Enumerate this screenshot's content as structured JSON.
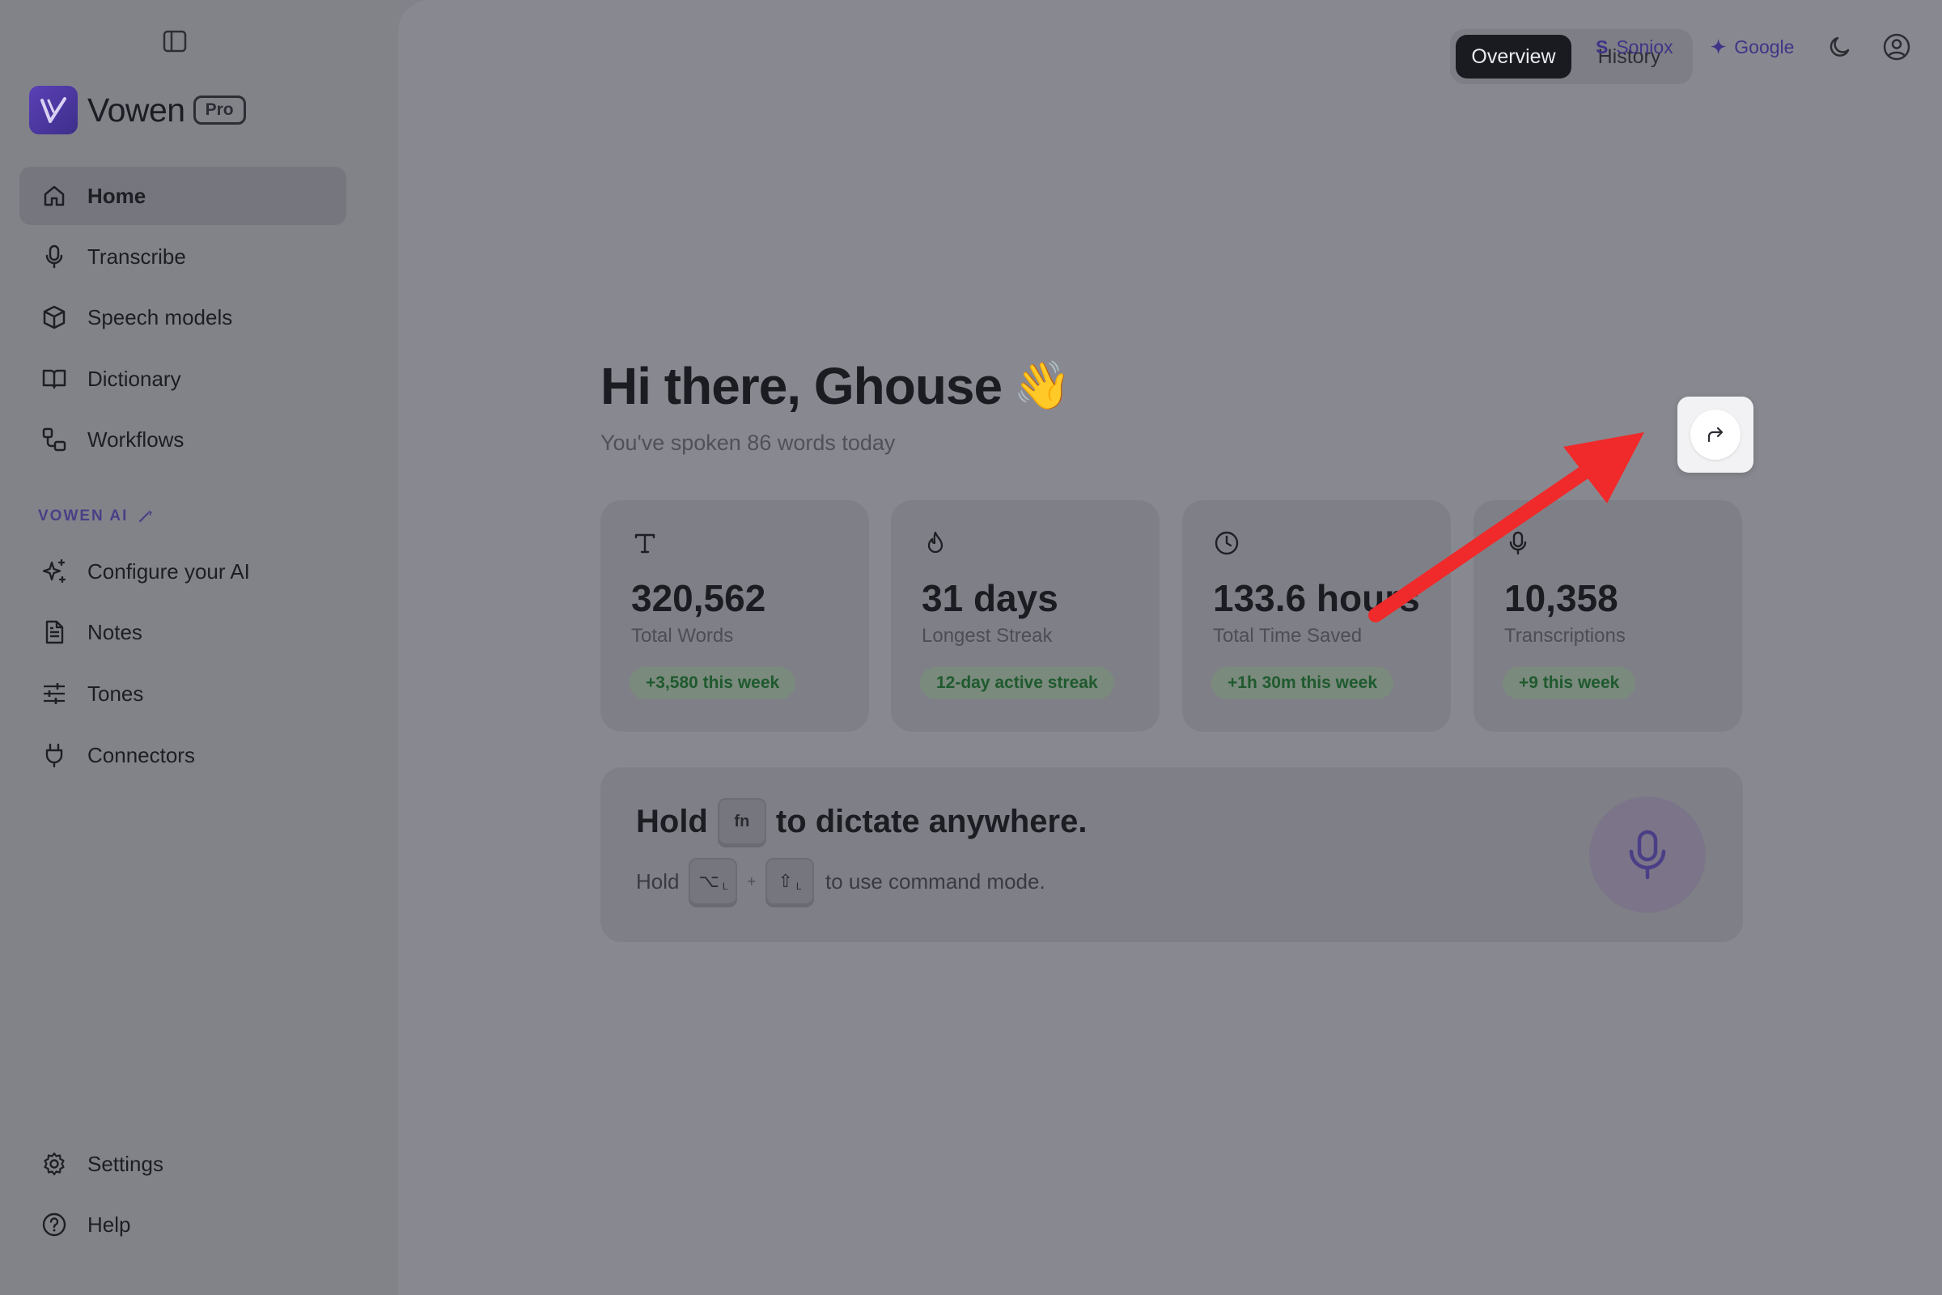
{
  "sidebar": {
    "brand": "Vowen",
    "plan_badge": "Pro",
    "items": [
      {
        "label": "Home",
        "icon": "home-icon"
      },
      {
        "label": "Transcribe",
        "icon": "microphone-icon"
      },
      {
        "label": "Speech models",
        "icon": "cube-icon"
      },
      {
        "label": "Dictionary",
        "icon": "book-icon"
      },
      {
        "label": "Workflows",
        "icon": "workflow-icon"
      }
    ],
    "ai_section_title": "VOWEN AI",
    "ai_items": [
      {
        "label": "Configure your AI",
        "icon": "sparkles-icon"
      },
      {
        "label": "Notes",
        "icon": "document-icon"
      },
      {
        "label": "Tones",
        "icon": "sliders-icon"
      },
      {
        "label": "Connectors",
        "icon": "plug-icon"
      }
    ],
    "bottom_items": [
      {
        "label": "Settings",
        "icon": "gear-icon"
      },
      {
        "label": "Help",
        "icon": "help-icon"
      }
    ]
  },
  "header": {
    "tabs": [
      "Overview",
      "History"
    ],
    "active_tab": "Overview",
    "providers": [
      {
        "label": "Soniox",
        "glyph": "S"
      },
      {
        "label": "Google",
        "glyph": "✦"
      }
    ]
  },
  "main": {
    "greeting": "Hi there, Ghouse",
    "greeting_emoji": "👋",
    "subtitle": "You've spoken 86 words today",
    "stats": [
      {
        "value": "320,562",
        "label": "Total Words",
        "badge": "+3,580 this week",
        "icon": "text-icon"
      },
      {
        "value": "31 days",
        "label": "Longest Streak",
        "badge": "12-day active streak",
        "icon": "flame-icon"
      },
      {
        "value": "133.6 hours",
        "label": "Total Time Saved",
        "badge": "+1h 30m this week",
        "icon": "clock-icon"
      },
      {
        "value": "10,358",
        "label": "Transcriptions",
        "badge": "+9 this week",
        "icon": "microphone-icon"
      }
    ],
    "dictate": {
      "hold": "Hold",
      "key_fn": "fn",
      "title_rest": "to dictate anywhere.",
      "sub_hold": "Hold",
      "key_option": "⌥",
      "key_shift": "⇧",
      "key_side": "L",
      "plus": "+",
      "sub_rest": "to use command mode."
    }
  },
  "colors": {
    "accent": "#4a3f86",
    "logo": "#5b40b6",
    "arrow": "#f02a2a",
    "badge_text": "#1f5a2e"
  }
}
